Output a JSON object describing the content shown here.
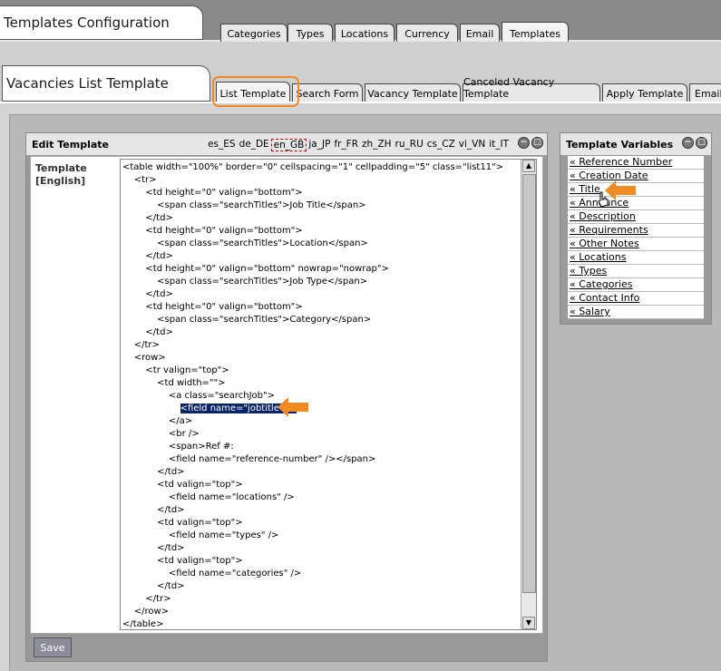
{
  "top": {
    "title": "Templates Configuration",
    "tabs": [
      {
        "label": "Categories"
      },
      {
        "label": "Types"
      },
      {
        "label": "Locations"
      },
      {
        "label": "Currency"
      },
      {
        "label": "Email"
      },
      {
        "label": "Templates"
      }
    ]
  },
  "second": {
    "title": "Vacancies List Template",
    "tabs": [
      {
        "label": "List Template"
      },
      {
        "label": "Search Form"
      },
      {
        "label": "Vacancy Template"
      },
      {
        "label": "Canceled Vacancy Template"
      },
      {
        "label": "Apply Template"
      },
      {
        "label": "Email T"
      }
    ]
  },
  "edit": {
    "title": "Edit Template",
    "languages": [
      "es_ES",
      "de_DE",
      "en_GB",
      "ja_JP",
      "fr_FR",
      "zh_ZH",
      "ru_RU",
      "cs_CZ",
      "vi_VN",
      "it_IT"
    ],
    "selected_language": "en_GB",
    "template_label_1": "Template",
    "template_label_2": "[English]",
    "code_lines": [
      "<table width=\"100%\" border=\"0\" cellspacing=\"1\" cellpadding=\"5\" class=\"list11\">",
      "    <tr>",
      "        <td height=\"0\" valign=\"bottom\">",
      "            <span class=\"searchTitles\">Job Title</span>",
      "        </td>",
      "        <td height=\"0\" valign=\"bottom\">",
      "            <span class=\"searchTitles\">Location</span>",
      "        </td>",
      "        <td height=\"0\" valign=\"bottom\" nowrap=\"nowrap\">",
      "            <span class=\"searchTitles\">Job Type</span>",
      "        </td>",
      "        <td height=\"0\" valign=\"bottom\">",
      "            <span class=\"searchTitles\">Category</span>",
      "        </td>",
      "    </tr>",
      "    <row>",
      "        <tr valign=\"top\">",
      "            <td width=\"\">",
      "                <a class=\"searchJob\">",
      "                    <field name=\"jobtitle\" />",
      "                </a>",
      "                <br />",
      "                <span>Ref #:",
      "                <field name=\"reference-number\" /></span>",
      "            </td>",
      "            <td valign=\"top\">",
      "                <field name=\"locations\" />",
      "            </td>",
      "            <td valign=\"top\">",
      "                <field name=\"types\" />",
      "            </td>",
      "            <td valign=\"top\">",
      "                <field name=\"categories\" />",
      "            </td>",
      "        </tr>",
      "    </row>",
      "</table>"
    ],
    "highlighted_line": 19,
    "save_label": "Save"
  },
  "variables": {
    "title": "Template Variables",
    "items": [
      {
        "label": "« Reference Number"
      },
      {
        "label": "« Creation Date"
      },
      {
        "label": "« Title"
      },
      {
        "label": "« Announce"
      },
      {
        "label": "« Description"
      },
      {
        "label": "« Requirements"
      },
      {
        "label": "« Other Notes"
      },
      {
        "label": "« Locations"
      },
      {
        "label": "« Types"
      },
      {
        "label": "« Categories"
      },
      {
        "label": "« Contact Info"
      },
      {
        "label": "« Salary"
      }
    ]
  },
  "colors": {
    "annotation": "#f08a24",
    "selection": "#0a246a"
  }
}
